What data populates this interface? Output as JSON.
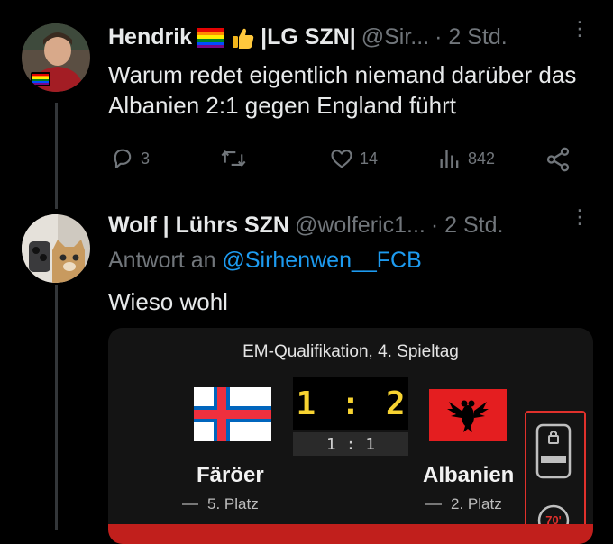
{
  "tweet1": {
    "author": "Hendrik",
    "author_suffix": "|LG SZN|",
    "handle": "@Sir...",
    "time": "· 2 Std.",
    "text": "Warum redet eigentlich niemand darüber das Albanien 2:1 gegen England führt",
    "replies": "3",
    "likes": "14",
    "views": "842"
  },
  "tweet2": {
    "author": "Wolf | Lührs SZN",
    "handle": "@wolferic1...",
    "time": "· 2 Std.",
    "reply_prefix": "Antwort an",
    "reply_to": "@Sirhenwen__FCB",
    "text": "Wieso wohl"
  },
  "card": {
    "title": "EM-Qualifikation, 4. Spieltag",
    "score_home": "1",
    "score_sep": ":",
    "score_away": "2",
    "halftime": "1 : 1",
    "home_team": "Färöer",
    "home_place": "5. Platz",
    "away_team": "Albanien",
    "away_place": "2. Platz",
    "badge": "70'"
  },
  "colors": {
    "background": "#000000",
    "link": "#1d9bf0",
    "muted": "#71767b",
    "score_yellow": "#f7d331",
    "accent_red": "#e0312c"
  }
}
